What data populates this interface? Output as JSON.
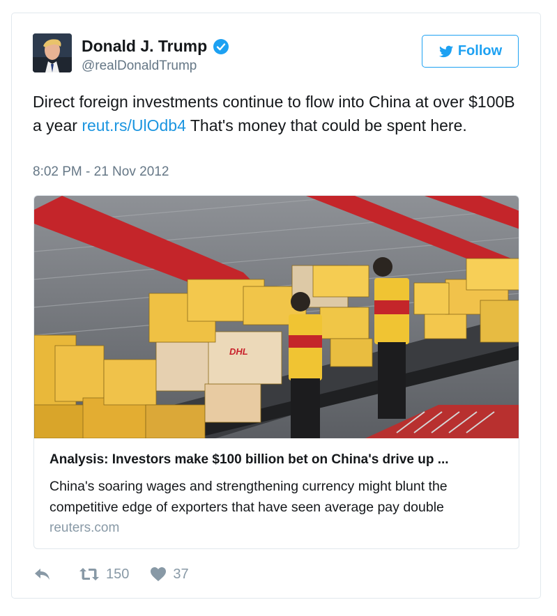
{
  "tweet": {
    "author_name": "Donald J. Trump",
    "handle": "@realDonaldTrump",
    "follow_label": "Follow",
    "text_before_link": "Direct foreign investments continue to flow into China at over $100B a year ",
    "link_text": "reut.rs/UlOdb4",
    "text_after_link": " That's money that could be spent here.",
    "timestamp": "8:02 PM - 21 Nov 2012",
    "icons": {
      "verified": "verified-badge-icon",
      "follow": "twitter-bird-icon",
      "reply": "reply-icon",
      "retweet": "retweet-icon",
      "like": "heart-icon"
    }
  },
  "link_card": {
    "title": "Analysis: Investors make $100 billion bet on China's drive up ...",
    "description": "China's soaring wages and strengthening currency might blunt the competitive edge of exporters that have seen average pay double",
    "domain": "reuters.com",
    "box_label": "DHL"
  },
  "actions": {
    "retweet_count": "150",
    "like_count": "37"
  },
  "colors": {
    "accent": "#1da1f2",
    "link": "#1b95e0",
    "muted": "#657786"
  }
}
